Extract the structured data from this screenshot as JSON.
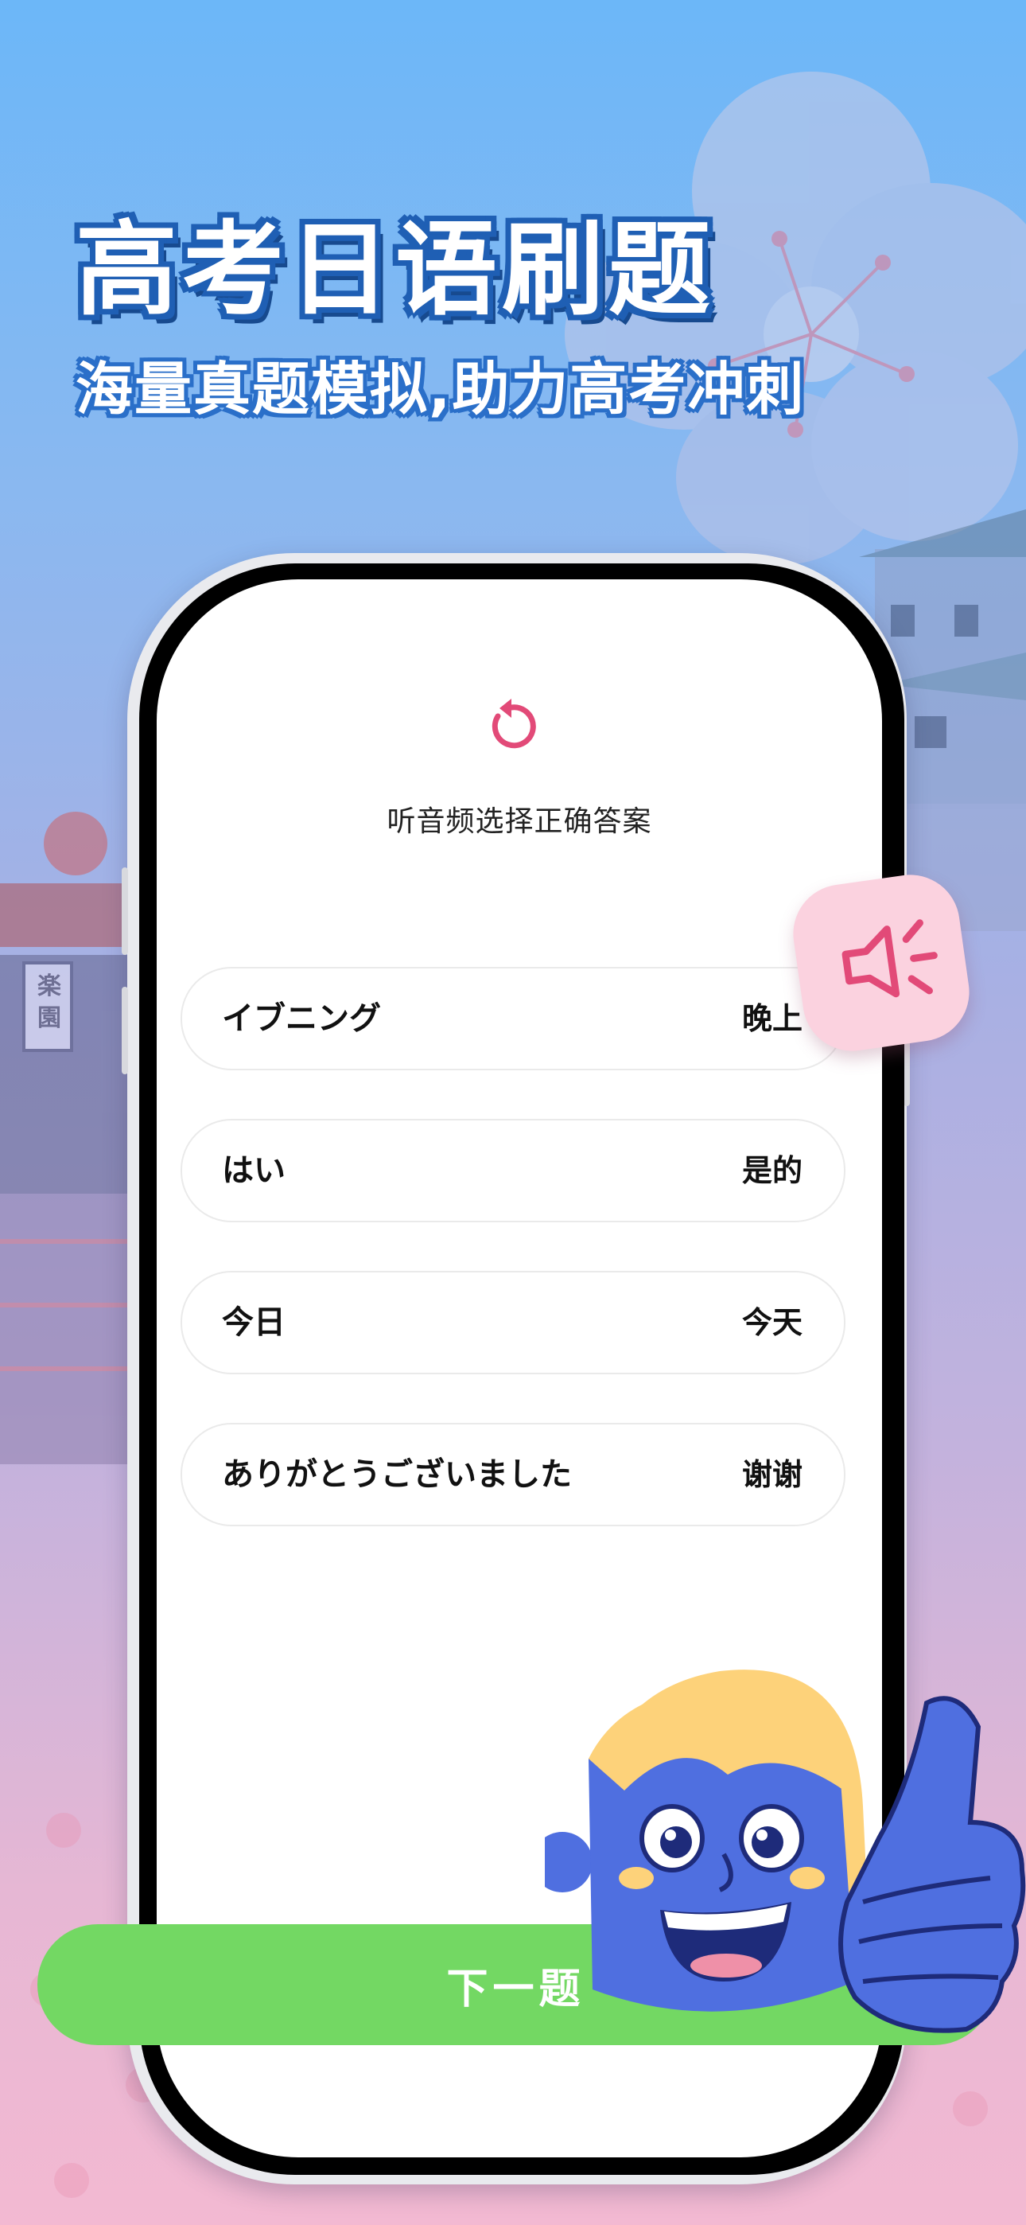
{
  "promo": {
    "headline": "高考日语刷题",
    "subheadline": "海量真题模拟,助力高考冲刺"
  },
  "quiz": {
    "replay_icon": "replay-icon",
    "instruction": "听音频选择正确答案",
    "options": [
      {
        "japanese": "イブニング",
        "chinese": "晚上"
      },
      {
        "japanese": "はい",
        "chinese": "是的"
      },
      {
        "japanese": "今日",
        "chinese": "今天"
      },
      {
        "japanese": "ありがとうございました",
        "chinese": "谢谢"
      }
    ],
    "speaker_icon": "speaker-icon",
    "next_label": "下一题"
  },
  "decor": {
    "sign_text": "楽園"
  },
  "colors": {
    "accent_pink": "#e24a78",
    "button_green": "#73d863",
    "headline_outline": "#1f5fb4"
  }
}
